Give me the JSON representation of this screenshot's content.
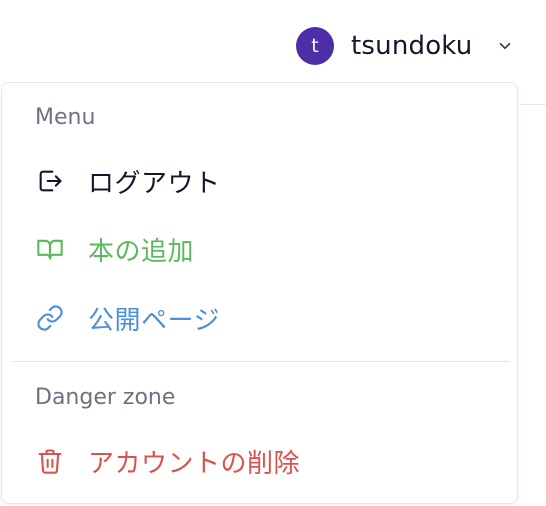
{
  "user": {
    "avatar_initial": "t",
    "name": "tsundoku",
    "avatar_color": "#4c2fa6"
  },
  "menu": {
    "section_label": "Menu",
    "items": [
      {
        "label": "ログアウト",
        "icon": "logout-icon",
        "color": "#111827"
      },
      {
        "label": "本の追加",
        "icon": "book-open-icon",
        "color": "#5cb85c"
      },
      {
        "label": "公開ページ",
        "icon": "link-icon",
        "color": "#4a90d9"
      }
    ]
  },
  "danger_zone": {
    "section_label": "Danger zone",
    "items": [
      {
        "label": "アカウントの削除",
        "icon": "trash-icon",
        "color": "#d9534f"
      }
    ]
  }
}
